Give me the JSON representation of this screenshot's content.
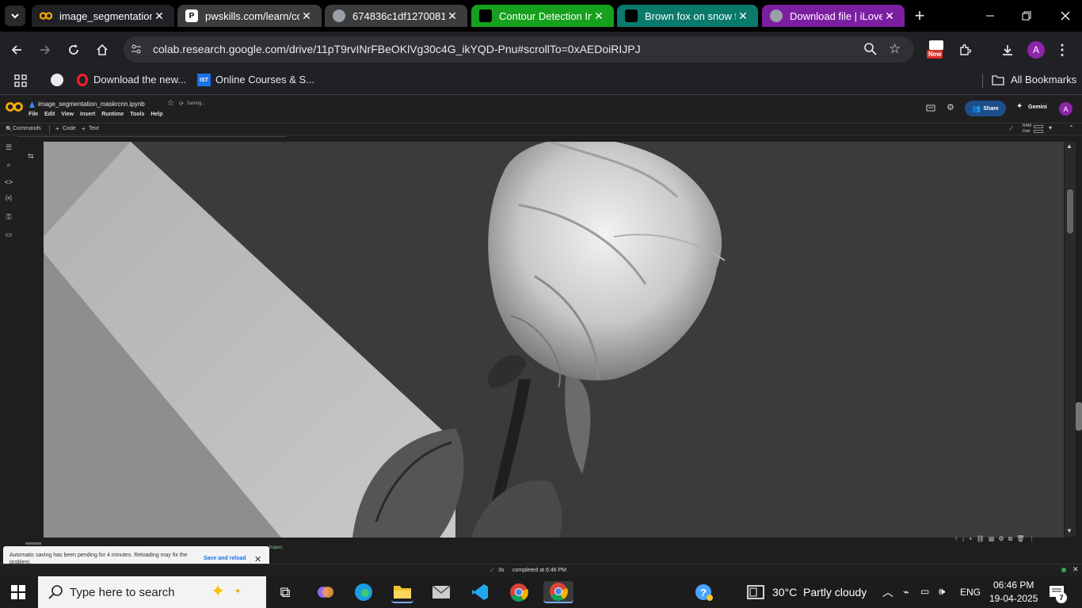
{
  "tabs": [
    {
      "title": "image_segmentation_",
      "close": "✕",
      "active": true
    },
    {
      "title": "pwskills.com/learn/co",
      "close": "✕"
    },
    {
      "title": "674836c1df12700814",
      "close": "✕"
    },
    {
      "title": "Contour Detection In",
      "close": "✕"
    },
    {
      "title": "Brown fox on snow fi",
      "close": "✕"
    },
    {
      "title": "Download file | iLoveI",
      "close": "✕"
    }
  ],
  "tab_colors": {
    "tab3": "#16a01e",
    "tab4": "#0a7a6b",
    "tab5": "#7b1fa2"
  },
  "address": {
    "url": "colab.research.google.com/drive/11pT9rvINrFBeOKlVg30c4G_ikYQD-Pnu#scrollTo=0xAEDoiRIJPJ"
  },
  "toolbar": {
    "new_badge": "New",
    "profile_initial": "A"
  },
  "bookmarks": {
    "items": [
      "Download the new...",
      "Online Courses & S..."
    ],
    "all_label": "All Bookmarks",
    "ist_badge": "IST"
  },
  "colab": {
    "filename": "image_segmentation_maskrcnn.ipynb",
    "saving": "Saving...",
    "menu": [
      "File",
      "Edit",
      "View",
      "Insert",
      "Runtime",
      "Tools",
      "Help"
    ],
    "share": "Share",
    "gemini": "Gemini",
    "commands": "Commands",
    "code": "Code",
    "text": "Text",
    "ram": "RAM",
    "disk": "Disk",
    "avatar": "A"
  },
  "cell_output_hint": "hapes",
  "toast": {
    "message": "Automatic saving has been pending for 4 minutes. Reloading may fix the problem.",
    "action": "Save and reload"
  },
  "status": {
    "duration": "3s",
    "completed": "completed at 6:46 PM"
  },
  "taskbar": {
    "search_placeholder": "Type here to search",
    "weather": "30°C  Partly cloudy",
    "language": "ENG",
    "time": "06:46 PM",
    "date": "19-04-2025",
    "notifications": "7"
  }
}
